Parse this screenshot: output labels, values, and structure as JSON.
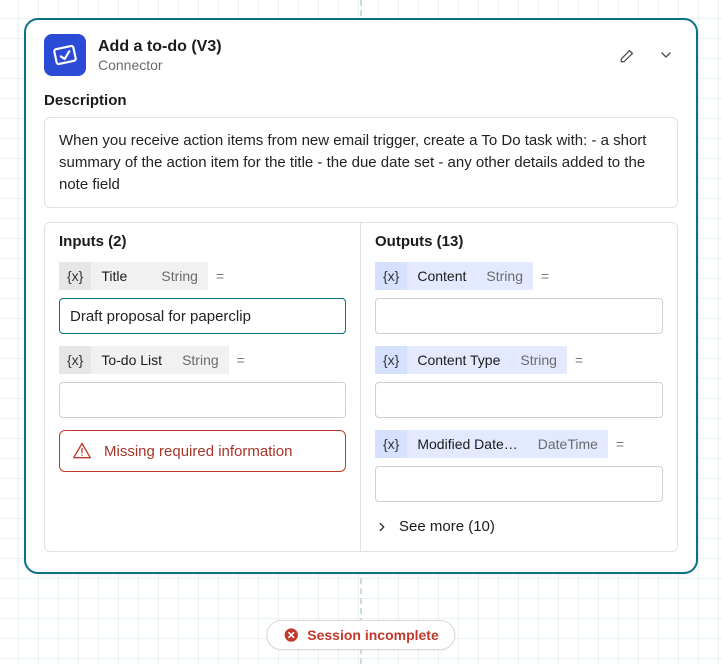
{
  "header": {
    "title": "Add a to-do (V3)",
    "subtitle": "Connector"
  },
  "description": {
    "label": "Description",
    "text": "When you receive action items from new email trigger, create a To Do task with: - a short summary of the action item for the title - the due date set - any other details added to the note field"
  },
  "inputs": {
    "title": "Inputs (2)",
    "fields": [
      {
        "fx": "{x}",
        "name": "Title",
        "type": "String",
        "eq": "=",
        "value": "Draft proposal for paperclip",
        "active": true
      },
      {
        "fx": "{x}",
        "name": "To-do List",
        "type": "String",
        "eq": "=",
        "value": "",
        "active": false
      }
    ],
    "error": "Missing required information"
  },
  "outputs": {
    "title": "Outputs (13)",
    "fields": [
      {
        "fx": "{x}",
        "name": "Content",
        "type": "String",
        "eq": "=",
        "value": ""
      },
      {
        "fx": "{x}",
        "name": "Content Type",
        "type": "String",
        "eq": "=",
        "value": ""
      },
      {
        "fx": "{x}",
        "name": "Modified Date…",
        "type": "DateTime",
        "eq": "=",
        "value": ""
      }
    ],
    "see_more": "See more (10)"
  },
  "status": {
    "label": "Session incomplete"
  },
  "colors": {
    "brand_blue": "#2b4bd6",
    "teal": "#0b7285",
    "error_red": "#c0392b"
  }
}
